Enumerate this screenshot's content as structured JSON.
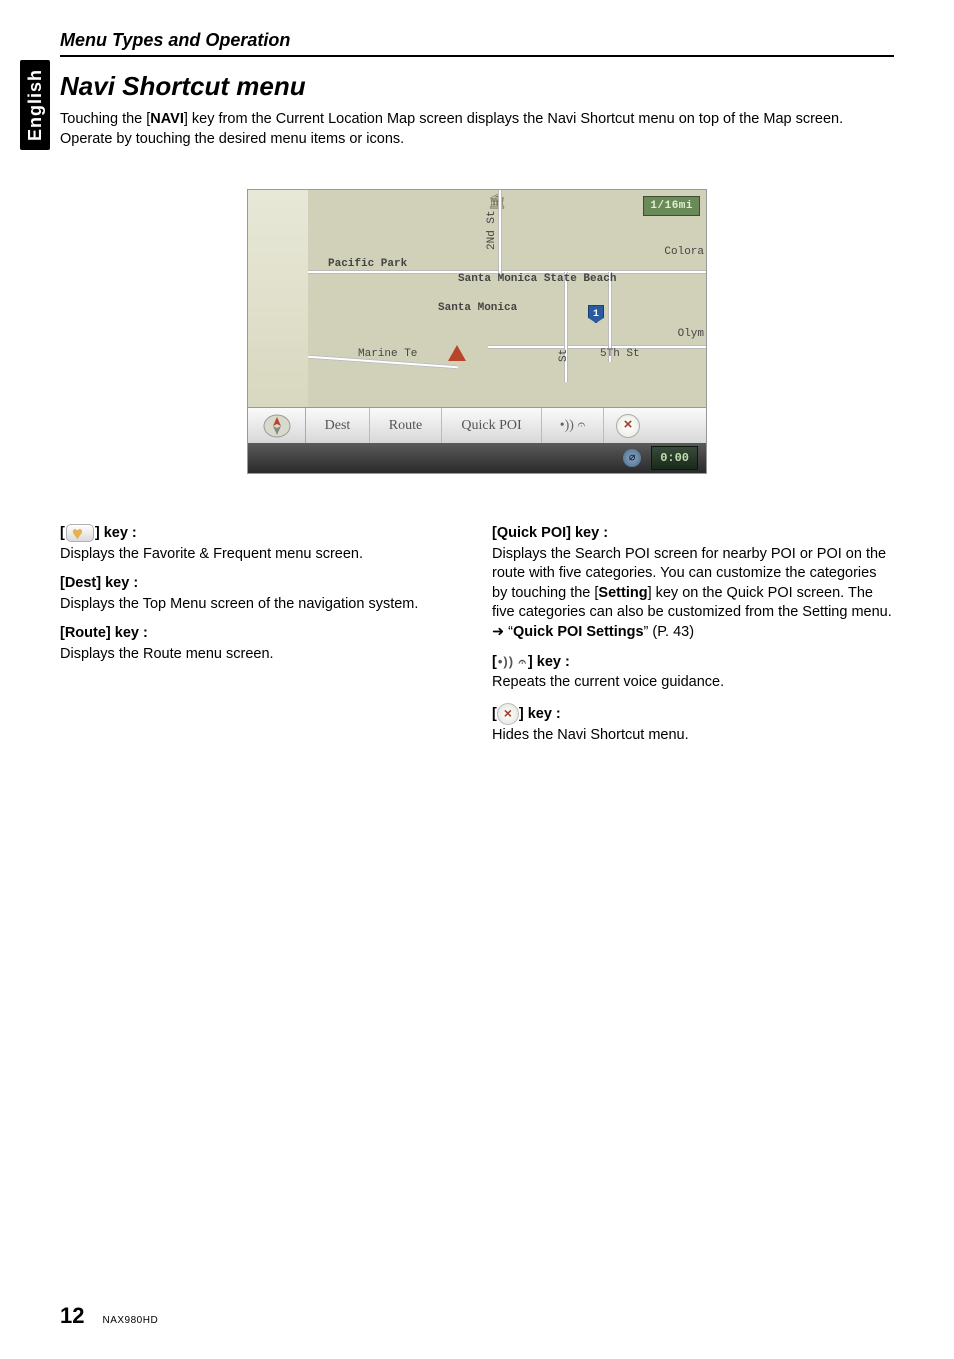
{
  "language_tab": "English",
  "breadcrumb": "Menu Types and Operation",
  "section_title": "Navi Shortcut menu",
  "intro_pre": "Touching the [",
  "intro_bold": "NAVI",
  "intro_post": "] key from the Current Location Map screen displays the Navi Shortcut menu on top of the Map screen. Operate by touching the desired menu items or icons.",
  "screenshot": {
    "scale": "1/16mi",
    "labels": {
      "pacific_park": "Pacific Park",
      "sm_state_beach": "Santa Monica State Beach",
      "santa_monica": "Santa Monica",
      "marine_te": "Marine Te",
      "second_st": "2Nd St",
      "colora": "Colora",
      "olym": "Olym",
      "st": "St",
      "fifth_st": "5Th St",
      "route_num": "1"
    },
    "nav": {
      "dest": "Dest",
      "route": "Route",
      "qpoi": "Quick POI"
    },
    "status_time": "0:00"
  },
  "left": {
    "fav": {
      "label_pre": "[",
      "label_post": "] key :",
      "desc": "Displays the Favorite & Frequent menu screen."
    },
    "dest": {
      "label": "[Dest] key :",
      "desc": "Displays the Top Menu screen of the navigation system."
    },
    "route": {
      "label": "[Route] key :",
      "desc": "Displays the Route menu screen."
    }
  },
  "right": {
    "qpoi": {
      "label": "[Quick POI] key :",
      "desc_pre": "Displays the Search POI screen for nearby POI or POI on the route with five categories. You can customize the categories by touching the [",
      "desc_bold1": "Setting",
      "desc_mid": "] key on the Quick POI screen. The five categories can also be customized from the Setting menu. ",
      "arrow": "➜",
      "quote_open": " “",
      "desc_bold2": "Quick POI Settings",
      "desc_post": "” (P. 43)"
    },
    "voice": {
      "label_pre": "[",
      "label_post": "] key :",
      "desc": "Repeats the current voice guidance."
    },
    "close": {
      "label_pre": "[",
      "label_post": "] key :",
      "desc": "Hides the Navi Shortcut menu."
    }
  },
  "footer": {
    "page": "12",
    "model": "NAX980HD"
  }
}
